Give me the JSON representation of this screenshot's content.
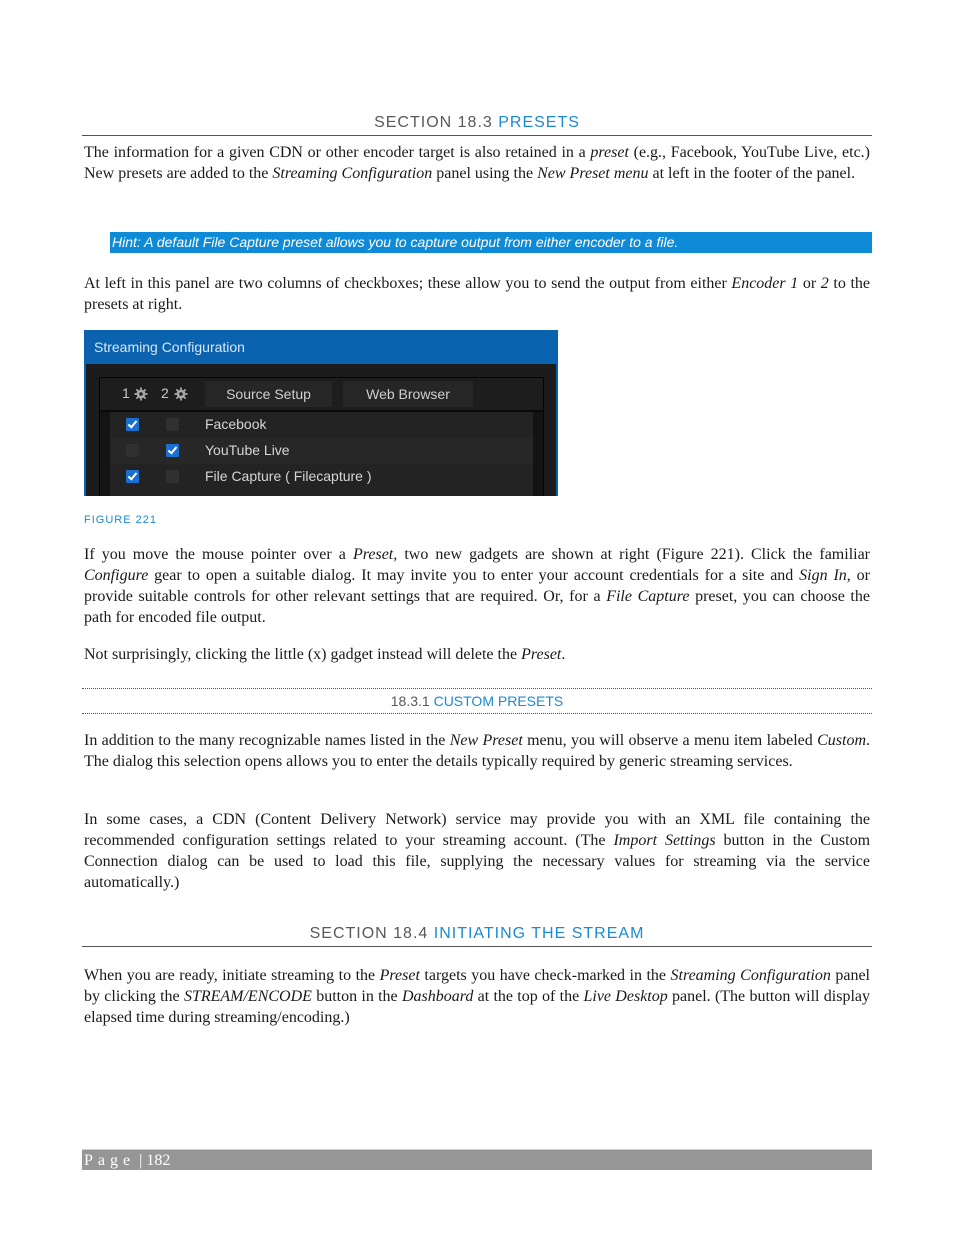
{
  "section_18_3": {
    "prefix": "SECTION 18.3",
    "title": "PRESETS",
    "para1": [
      "The information for a given CDN or other encoder target is also retained in a ",
      "preset",
      " (e.g., Facebook, YouTube Live, etc.) New presets are added to the ",
      "Streaming Configuration",
      " panel using the ",
      "New Preset menu",
      " at left in the footer of the panel."
    ],
    "hint": "Hint: A default File Capture preset allows you to capture output from either encoder to a file.",
    "para2": [
      "At left in this panel are two columns of checkboxes; these allow you to send the output from either ",
      "Encoder 1",
      " or ",
      "2",
      " to the presets at right."
    ]
  },
  "figure": {
    "panel_title": "Streaming Configuration",
    "encoder1_label": "1",
    "encoder2_label": "2",
    "gear_icon": "gear-icon",
    "buttons": [
      "Source Setup",
      "Web Browser"
    ],
    "presets": [
      {
        "label": "Facebook",
        "enc1": true,
        "enc2": false
      },
      {
        "label": "YouTube Live",
        "enc1": false,
        "enc2": true
      },
      {
        "label": "File Capture ( Filecapture )",
        "enc1": true,
        "enc2": false
      }
    ],
    "caption": "FIGURE 221",
    "colors": {
      "title_bar": "#0b63b0",
      "checked": "#1a6fd0"
    }
  },
  "para3": [
    "If you move the mouse pointer over a ",
    "Preset,",
    " two new gadgets are shown at right (Figure 221).  Click the familiar ",
    "Configure",
    " gear to open a suitable dialog.  It may invite you to enter your account credentials for a site and ",
    "Sign In",
    ", or provide suitable controls for other relevant settings that are required.  Or, for a ",
    "File Capture",
    " preset, you can choose the path for encoded file output."
  ],
  "para4": [
    "Not surprisingly, clicking the little (x) gadget instead will delete the ",
    "Preset",
    "."
  ],
  "section_18_3_1": {
    "prefix": "18.3.1",
    "title": "CUSTOM PRESETS",
    "para1": [
      "In addition to the many recognizable names listed in the ",
      "New Preset",
      " menu, you will observe a menu item labeled ",
      "Custom",
      ". The dialog this selection opens allows you to enter the details typically required by generic streaming services."
    ],
    "para2": [
      "In some cases, a CDN (Content Delivery Network) service may provide you with an XML file containing the recommended configuration settings related to your streaming account.  (The ",
      "Import Settings",
      " button in the Custom Connection dialog can be used to load this file, supplying the necessary values for streaming via the service automatically.)"
    ]
  },
  "section_18_4": {
    "prefix": "SECTION 18.4",
    "title": "INITIATING THE STREAM",
    "para1": [
      "When you are ready, initiate streaming to the ",
      "Preset",
      " targets you have check-marked in the ",
      "Streaming Configuration",
      " panel by clicking the ",
      "STREAM/ENCODE",
      " button in the ",
      "Dashboard",
      " at the top of the ",
      "Live Desktop",
      " panel. (The button will display elapsed time during streaming/encoding.)"
    ]
  },
  "footer": {
    "page_label": "Page",
    "separator": "|",
    "page_number": "182"
  },
  "accent_color": "#1a8ad4"
}
